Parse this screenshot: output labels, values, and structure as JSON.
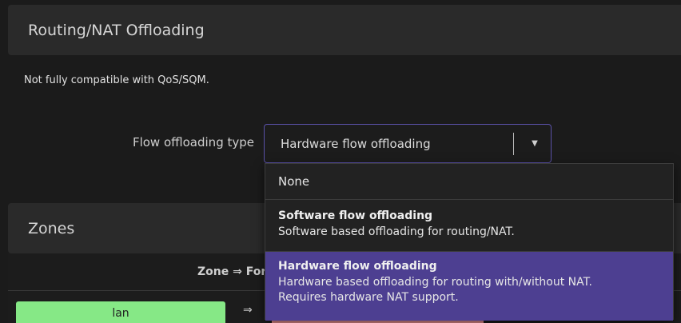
{
  "sections": {
    "routing_title": "Routing/NAT Offloading",
    "zones_title": "Zones"
  },
  "note": "Not fully compatible with QoS/SQM.",
  "flow_offloading": {
    "label": "Flow offloading type",
    "selected": "Hardware flow offloading",
    "options": [
      {
        "title": "None"
      },
      {
        "title": "Software flow offloading",
        "description": "Software based offloading for routing/NAT."
      },
      {
        "title": "Hardware flow offloading",
        "description_line1": "Hardware based offloading for routing with/without NAT.",
        "description_line2": "Requires hardware NAT support."
      }
    ]
  },
  "zones_table": {
    "column_header": "Zone ⇒ For",
    "rows": [
      {
        "zone": "lan",
        "arrow": "⇒"
      }
    ]
  },
  "colors": {
    "accent_border": "#5a51a8",
    "selected_option": "#4d3f91",
    "lan_zone": "#86e886",
    "wan_zone": "#e89090"
  },
  "icons": {
    "select_arrow": "chevron-down-icon"
  }
}
